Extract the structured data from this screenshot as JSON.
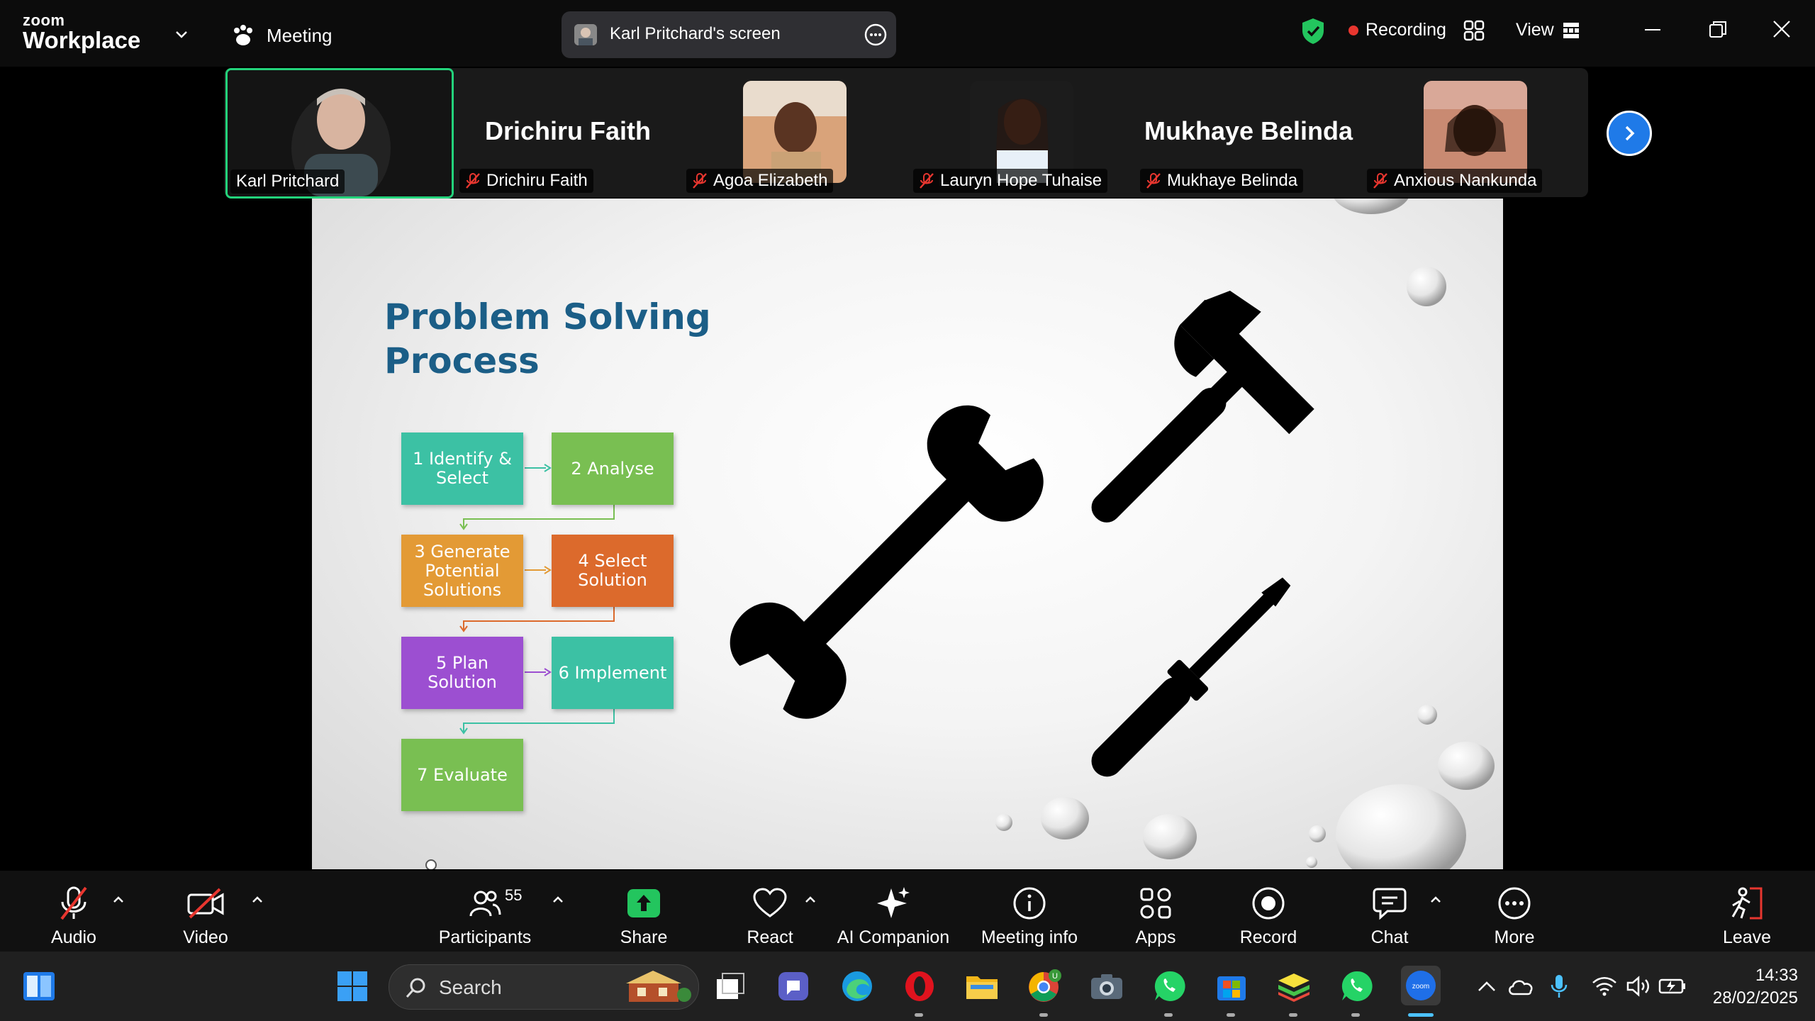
{
  "app": {
    "logo_small": "zoom",
    "logo_big": "Workplace",
    "meeting_label": "Meeting",
    "screen_share_label": "Karl Pritchard's screen",
    "recording_label": "Recording",
    "view_label": "View",
    "colors": {
      "active_border": "#23d37b",
      "recording": "#e8362f",
      "accent": "#1f7ae8"
    }
  },
  "gallery": {
    "tiles": [
      {
        "name": "Karl Pritchard",
        "muted": false,
        "active": true,
        "video": true
      },
      {
        "name": "Drichiru Faith",
        "big_name": "Drichiru Faith",
        "muted": true,
        "video": false
      },
      {
        "name": "Agoa Elizabeth",
        "muted": true,
        "video": true
      },
      {
        "name": "Lauryn Hope Tuhaise",
        "muted": true,
        "video": true
      },
      {
        "name": "Mukhaye Belinda",
        "big_name": "Mukhaye Belinda",
        "muted": true,
        "video": false
      },
      {
        "name": "Anxious Nankunda",
        "muted": true,
        "video": true
      }
    ]
  },
  "slide": {
    "title_line1": "Problem Solving",
    "title_line2": "Process",
    "steps": [
      {
        "label": "1 Identify & Select",
        "color": "#3cc1a4"
      },
      {
        "label": "2 Analyse",
        "color": "#79bf52"
      },
      {
        "label": "3 Generate Potential Solutions",
        "color": "#e39a35"
      },
      {
        "label": "4 Select Solution",
        "color": "#dc6a2c"
      },
      {
        "label": "5 Plan Solution",
        "color": "#9c4fd1"
      },
      {
        "label": "6 Implement",
        "color": "#3cc1a4"
      },
      {
        "label": "7 Evaluate",
        "color": "#79bf52"
      }
    ]
  },
  "toolbar": {
    "audio": "Audio",
    "video": "Video",
    "participants": "Participants",
    "participant_count": "55",
    "share": "Share",
    "react": "React",
    "ai_companion": "AI Companion",
    "meeting_info": "Meeting info",
    "apps": "Apps",
    "record": "Record",
    "chat": "Chat",
    "more": "More",
    "leave": "Leave"
  },
  "taskbar": {
    "search_placeholder": "Search",
    "time": "14:33",
    "date": "28/02/2025"
  }
}
